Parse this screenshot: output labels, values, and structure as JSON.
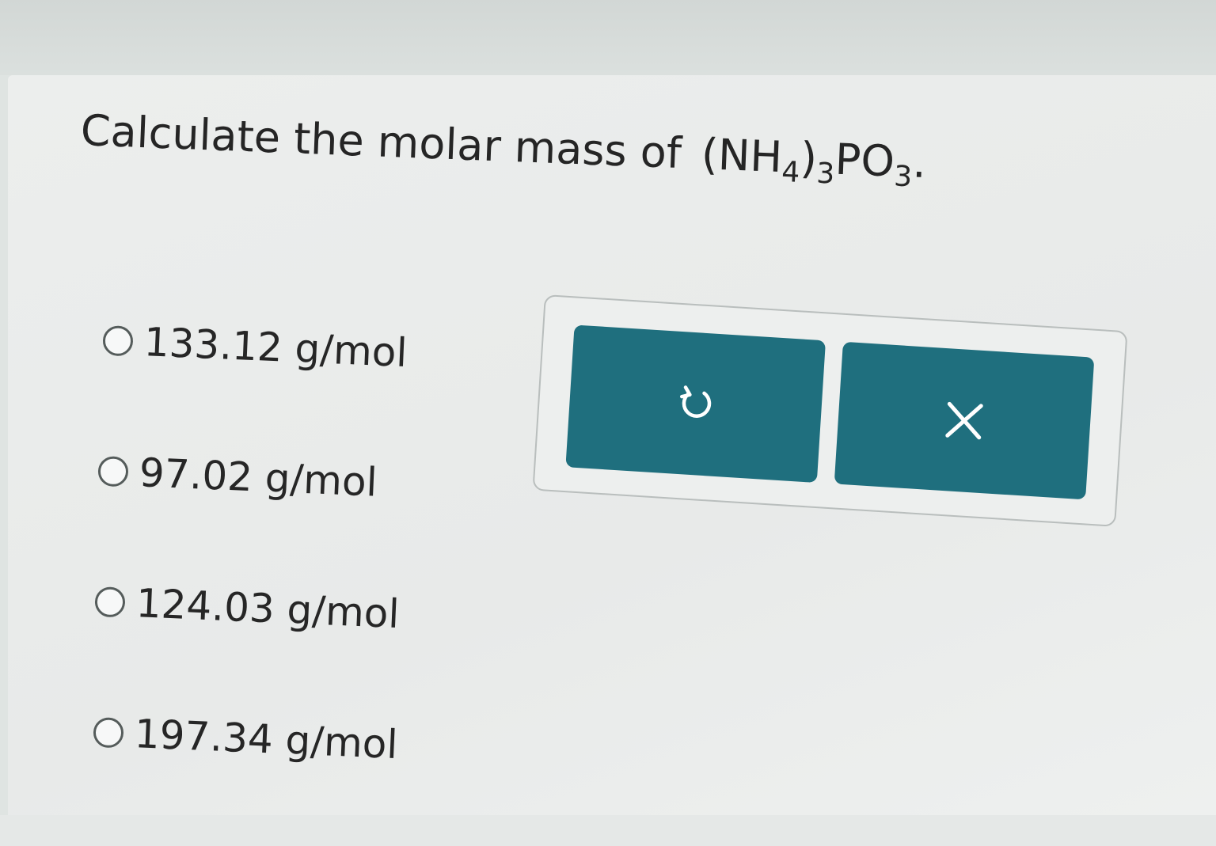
{
  "question": {
    "prefix": "Calculate the molar mass of ",
    "formula": {
      "open": "(NH",
      "sub1": "4",
      "mid": ")",
      "sub2": "3",
      "po": "PO",
      "sub3": "3",
      "end": "."
    }
  },
  "options": [
    {
      "label": "133.12 g/mol"
    },
    {
      "label": "97.02 g/mol"
    },
    {
      "label": "124.03 g/mol"
    },
    {
      "label": "197.34 g/mol"
    }
  ],
  "toolbar": {
    "undo_icon": "undo-icon",
    "close_icon": "close-icon",
    "button_color": "#1f6f7e"
  }
}
